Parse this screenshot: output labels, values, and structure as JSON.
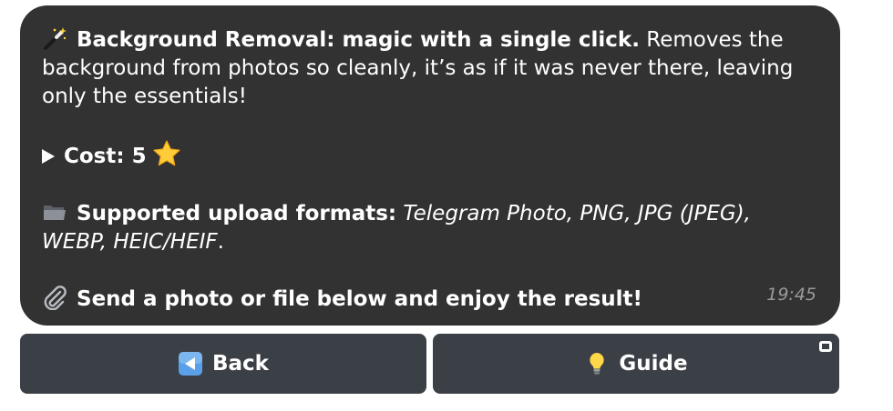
{
  "message": {
    "line1_bold": "Background Removal: magic with a single click.",
    "line1_rest": " Removes the background from photos so cleanly, it’s as if it was never there, leaving only the essentials!",
    "cost_label": "Cost: 5",
    "formats_label": "Supported upload formats:",
    "formats_value": " Telegram Photo, PNG, JPG (JPEG), WEBP, HEIC/HEIF",
    "formats_end": ".",
    "send_text": "Send a photo or file below and enjoy the result!",
    "time": "19:45"
  },
  "icons": {
    "wand": "magic-wand-icon",
    "play": "play-icon",
    "star": "star-icon",
    "folder": "folder-icon",
    "clip": "paperclip-icon",
    "back": "back-arrow-icon",
    "bulb": "lightbulb-icon"
  },
  "buttons": {
    "back_label": "Back",
    "guide_label": "Guide"
  },
  "colors": {
    "bubble_bg": "#323232",
    "button_bg": "#3b3f46",
    "timestamp": "#9a9a9a"
  }
}
